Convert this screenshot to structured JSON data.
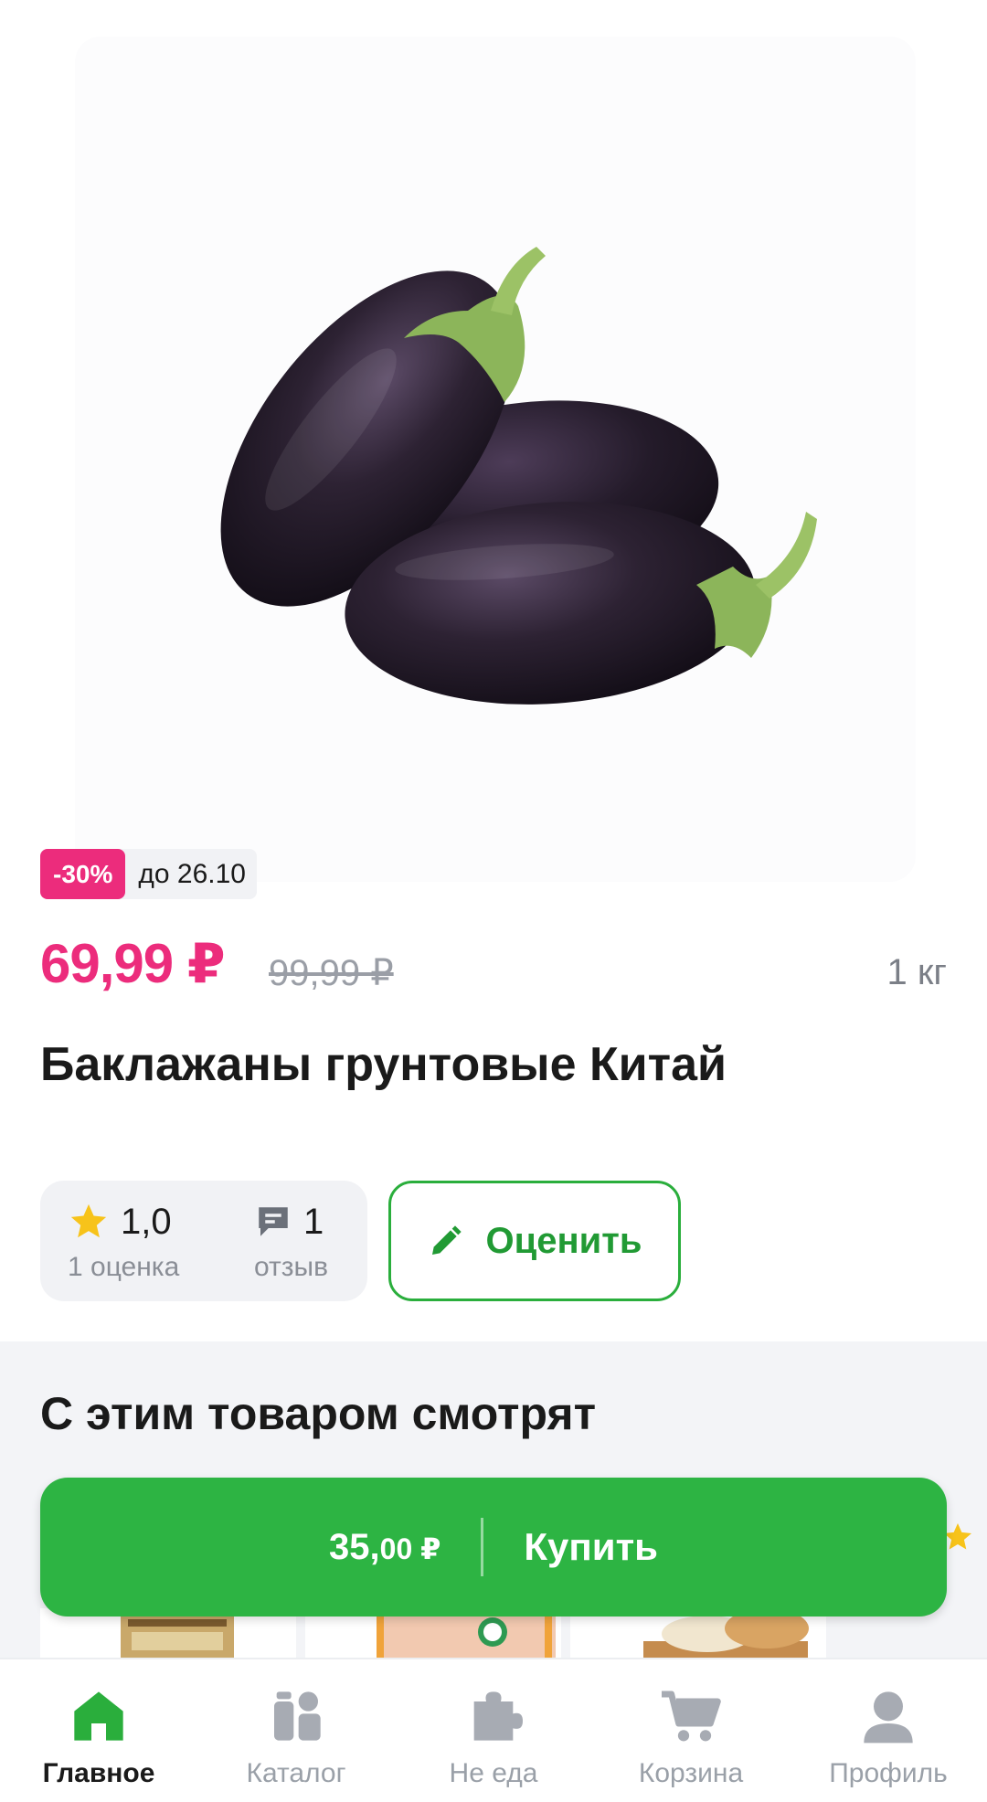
{
  "product": {
    "discount_badge": "-30%",
    "promo_until": "до 26.10",
    "price_current": "69,99 ₽",
    "price_old": "99,99 ₽",
    "weight": "1 кг",
    "title": "Баклажаны грунтовые Китай"
  },
  "rating": {
    "value": "1,0",
    "ratings_count_label": "1 оценка",
    "reviews_count": "1",
    "reviews_label": "отзыв",
    "rate_button_label": "Оценить"
  },
  "also_viewed": {
    "title": "С этим товаром смотрят"
  },
  "buy_bar": {
    "price_main": "35,",
    "price_small": "00 ₽",
    "button_label": "Купить"
  },
  "tabs": [
    {
      "label": "Главное",
      "icon": "home-icon",
      "active": true
    },
    {
      "label": "Каталог",
      "icon": "catalog-icon",
      "active": false
    },
    {
      "label": "Не еда",
      "icon": "puzzle-icon",
      "active": false
    },
    {
      "label": "Корзина",
      "icon": "cart-icon",
      "active": false
    },
    {
      "label": "Профиль",
      "icon": "profile-icon",
      "active": false
    }
  ],
  "colors": {
    "accent_pink": "#ec2c7c",
    "accent_green": "#2db443",
    "green_text": "#219a34",
    "star_yellow": "#f7c31a"
  }
}
